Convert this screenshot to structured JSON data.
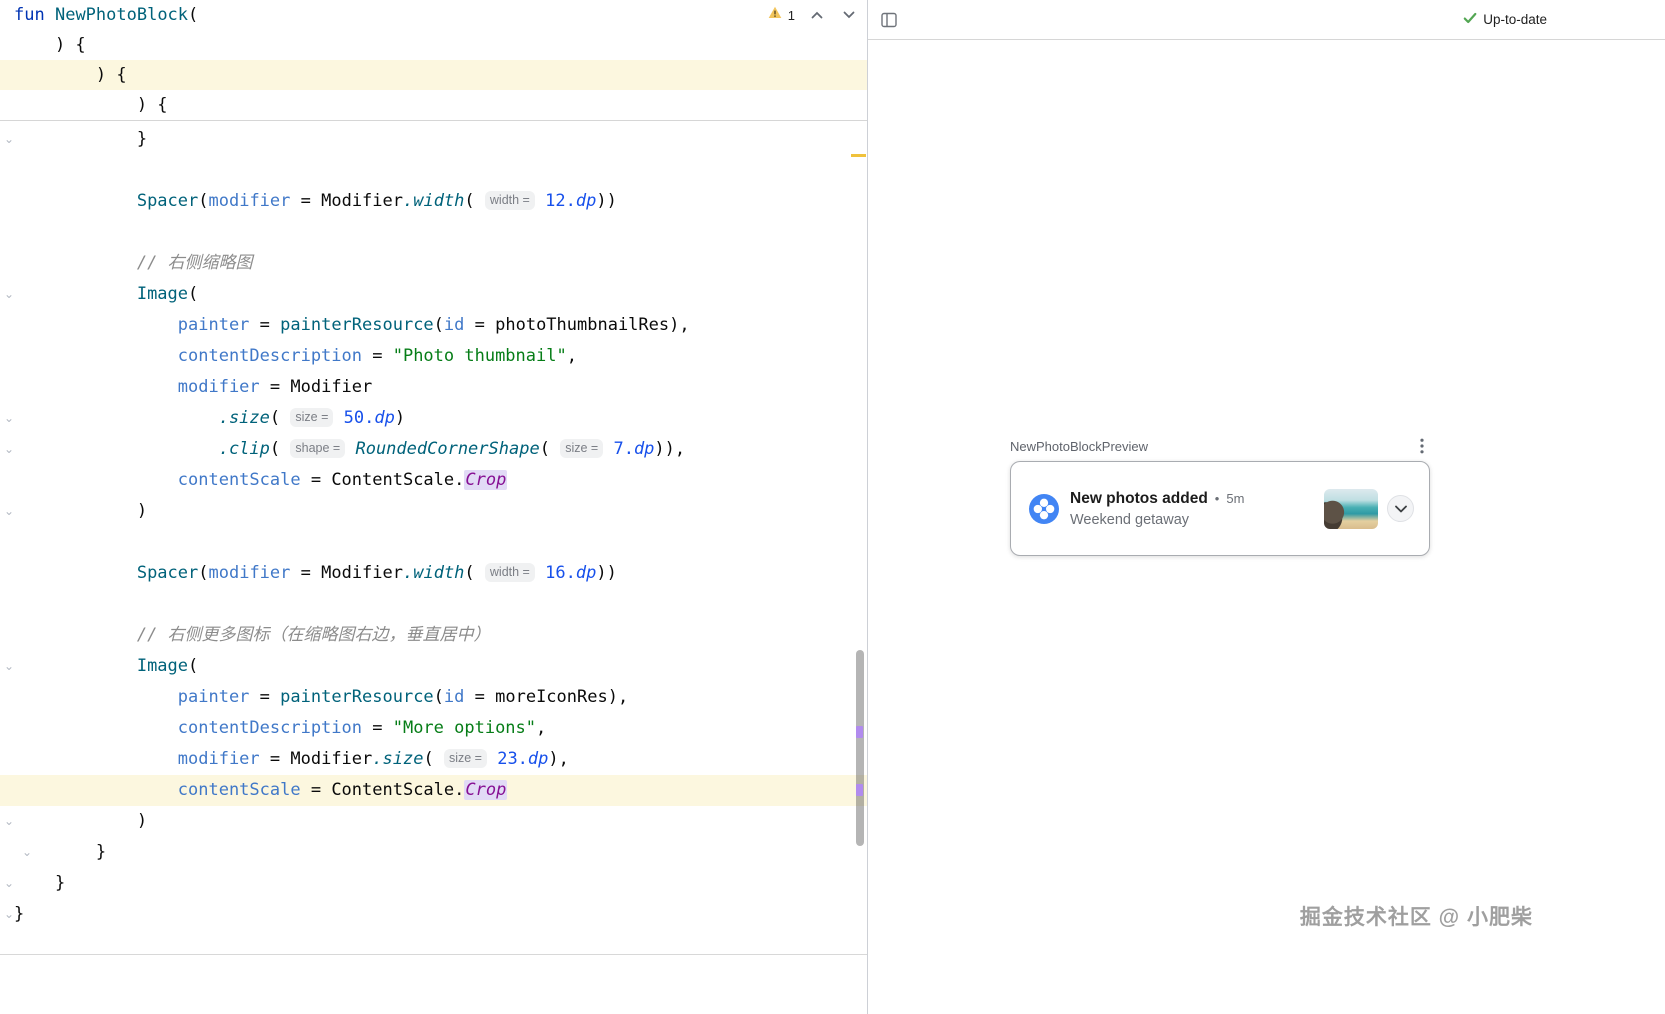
{
  "icons": {
    "fold_glyph": "⌄"
  },
  "editor": {
    "inspections": {
      "warning_count": "1"
    },
    "sticky_lines": [
      {
        "tokens": [
          {
            "t": "fun",
            "c": "kw"
          },
          {
            "t": " ",
            "c": "pl"
          },
          {
            "t": "NewPhotoBlock",
            "c": "fn"
          },
          {
            "t": "(",
            "c": "pl"
          }
        ]
      },
      {
        "tokens": [
          {
            "t": "    ) {",
            "c": "pl"
          }
        ]
      },
      {
        "hl": true,
        "tokens": [
          {
            "t": "        ) {",
            "c": "pl"
          }
        ]
      },
      {
        "tokens": [
          {
            "t": "            ) {",
            "c": "pl"
          }
        ]
      }
    ],
    "lines": [
      {
        "fold": 1,
        "tokens": [
          {
            "t": "            }",
            "c": "pl"
          }
        ]
      },
      {
        "tokens": []
      },
      {
        "tokens": [
          {
            "t": "            ",
            "c": "pl"
          },
          {
            "t": "Spacer",
            "c": "fn"
          },
          {
            "t": "(",
            "c": "pl"
          },
          {
            "t": "modifier",
            "c": "arg"
          },
          {
            "t": " = ",
            "c": "pl"
          },
          {
            "t": "Modifier",
            "c": "pl"
          },
          {
            "t": ".width",
            "c": "ext"
          },
          {
            "t": "( ",
            "c": "pl"
          },
          {
            "t": "width =",
            "c": "hint"
          },
          {
            "t": " ",
            "c": "pl"
          },
          {
            "t": "12.",
            "c": "num"
          },
          {
            "t": "dp",
            "c": "prop"
          },
          {
            "t": "))",
            "c": "pl"
          }
        ]
      },
      {
        "tokens": []
      },
      {
        "tokens": [
          {
            "t": "            ",
            "c": "pl"
          },
          {
            "t": "// 右侧缩略图",
            "c": "cmt"
          }
        ]
      },
      {
        "fold": 1,
        "tokens": [
          {
            "t": "            ",
            "c": "pl"
          },
          {
            "t": "Image",
            "c": "fn"
          },
          {
            "t": "(",
            "c": "pl"
          }
        ]
      },
      {
        "tokens": [
          {
            "t": "                ",
            "c": "pl"
          },
          {
            "t": "painter",
            "c": "arg"
          },
          {
            "t": " = ",
            "c": "pl"
          },
          {
            "t": "painterResource",
            "c": "fn"
          },
          {
            "t": "(",
            "c": "pl"
          },
          {
            "t": "id",
            "c": "arg"
          },
          {
            "t": " = ",
            "c": "pl"
          },
          {
            "t": "photoThumbnailRes",
            "c": "pl"
          },
          {
            "t": "),",
            "c": "pl"
          }
        ]
      },
      {
        "tokens": [
          {
            "t": "                ",
            "c": "pl"
          },
          {
            "t": "contentDescription",
            "c": "arg"
          },
          {
            "t": " = ",
            "c": "pl"
          },
          {
            "t": "\"Photo thumbnail\"",
            "c": "str"
          },
          {
            "t": ",",
            "c": "pl"
          }
        ]
      },
      {
        "tokens": [
          {
            "t": "                ",
            "c": "pl"
          },
          {
            "t": "modifier",
            "c": "arg"
          },
          {
            "t": " = ",
            "c": "pl"
          },
          {
            "t": "Modifier",
            "c": "pl"
          }
        ]
      },
      {
        "fold": 1,
        "tokens": [
          {
            "t": "                    ",
            "c": "pl"
          },
          {
            "t": ".size",
            "c": "ext"
          },
          {
            "t": "( ",
            "c": "pl"
          },
          {
            "t": "size =",
            "c": "hint"
          },
          {
            "t": " ",
            "c": "pl"
          },
          {
            "t": "50.",
            "c": "num"
          },
          {
            "t": "dp",
            "c": "prop"
          },
          {
            "t": ")",
            "c": "pl"
          }
        ]
      },
      {
        "fold": 1,
        "tokens": [
          {
            "t": "                    ",
            "c": "pl"
          },
          {
            "t": ".clip",
            "c": "ext"
          },
          {
            "t": "( ",
            "c": "pl"
          },
          {
            "t": "shape =",
            "c": "hint"
          },
          {
            "t": " ",
            "c": "pl"
          },
          {
            "t": "RoundedCornerShape",
            "c": "ctor"
          },
          {
            "t": "( ",
            "c": "pl"
          },
          {
            "t": "size =",
            "c": "hint"
          },
          {
            "t": " ",
            "c": "pl"
          },
          {
            "t": "7.",
            "c": "num"
          },
          {
            "t": "dp",
            "c": "prop"
          },
          {
            "t": ")),",
            "c": "pl"
          }
        ]
      },
      {
        "tokens": [
          {
            "t": "                ",
            "c": "pl"
          },
          {
            "t": "contentScale",
            "c": "arg"
          },
          {
            "t": " = ",
            "c": "pl"
          },
          {
            "t": "ContentScale.",
            "c": "pl"
          },
          {
            "t": "Crop",
            "c": "hlid"
          }
        ]
      },
      {
        "fold": 1,
        "tokens": [
          {
            "t": "            )",
            "c": "pl"
          }
        ]
      },
      {
        "tokens": []
      },
      {
        "tokens": [
          {
            "t": "            ",
            "c": "pl"
          },
          {
            "t": "Spacer",
            "c": "fn"
          },
          {
            "t": "(",
            "c": "pl"
          },
          {
            "t": "modifier",
            "c": "arg"
          },
          {
            "t": " = ",
            "c": "pl"
          },
          {
            "t": "Modifier",
            "c": "pl"
          },
          {
            "t": ".width",
            "c": "ext"
          },
          {
            "t": "( ",
            "c": "pl"
          },
          {
            "t": "width =",
            "c": "hint"
          },
          {
            "t": " ",
            "c": "pl"
          },
          {
            "t": "16.",
            "c": "num"
          },
          {
            "t": "dp",
            "c": "prop"
          },
          {
            "t": "))",
            "c": "pl"
          }
        ]
      },
      {
        "tokens": []
      },
      {
        "tokens": [
          {
            "t": "            ",
            "c": "pl"
          },
          {
            "t": "// 右侧更多图标（在缩略图右边，垂直居中）",
            "c": "cmt"
          }
        ]
      },
      {
        "fold": 1,
        "tokens": [
          {
            "t": "            ",
            "c": "pl"
          },
          {
            "t": "Image",
            "c": "fn"
          },
          {
            "t": "(",
            "c": "pl"
          }
        ]
      },
      {
        "tokens": [
          {
            "t": "                ",
            "c": "pl"
          },
          {
            "t": "painter",
            "c": "arg"
          },
          {
            "t": " = ",
            "c": "pl"
          },
          {
            "t": "painterResource",
            "c": "fn"
          },
          {
            "t": "(",
            "c": "pl"
          },
          {
            "t": "id",
            "c": "arg"
          },
          {
            "t": " = ",
            "c": "pl"
          },
          {
            "t": "moreIconRes",
            "c": "pl"
          },
          {
            "t": "),",
            "c": "pl"
          }
        ]
      },
      {
        "tokens": [
          {
            "t": "                ",
            "c": "pl"
          },
          {
            "t": "contentDescription",
            "c": "arg"
          },
          {
            "t": " = ",
            "c": "pl"
          },
          {
            "t": "\"More options\"",
            "c": "str"
          },
          {
            "t": ",",
            "c": "pl"
          }
        ]
      },
      {
        "tokens": [
          {
            "t": "                ",
            "c": "pl"
          },
          {
            "t": "modifier",
            "c": "arg"
          },
          {
            "t": " = ",
            "c": "pl"
          },
          {
            "t": "Modifier",
            "c": "pl"
          },
          {
            "t": ".size",
            "c": "ext"
          },
          {
            "t": "( ",
            "c": "pl"
          },
          {
            "t": "size =",
            "c": "hint"
          },
          {
            "t": " ",
            "c": "pl"
          },
          {
            "t": "23.",
            "c": "num"
          },
          {
            "t": "dp",
            "c": "prop"
          },
          {
            "t": "),",
            "c": "pl"
          }
        ]
      },
      {
        "hl": true,
        "tokens": [
          {
            "t": "                ",
            "c": "pl"
          },
          {
            "t": "contentScale",
            "c": "arg"
          },
          {
            "t": " = ",
            "c": "pl"
          },
          {
            "t": "ContentScale.",
            "c": "pl"
          },
          {
            "t": "Crop",
            "c": "hlid"
          }
        ]
      },
      {
        "fold": 1,
        "tokens": [
          {
            "t": "            )",
            "c": "pl"
          }
        ]
      },
      {
        "fold": 2,
        "tokens": [
          {
            "t": "        }",
            "c": "pl"
          }
        ]
      },
      {
        "fold": 1,
        "tokens": [
          {
            "t": "    }",
            "c": "pl"
          }
        ]
      },
      {
        "fold": 1,
        "tokens": [
          {
            "t": "}",
            "c": "pl"
          }
        ]
      }
    ]
  },
  "preview": {
    "toolbar": {
      "status": "Up-to-date"
    },
    "preview_name": "NewPhotoBlockPreview",
    "card": {
      "title": "New photos added",
      "separator": "•",
      "time": "5m",
      "subtitle": "Weekend getaway"
    },
    "watermark": "掘金技术社区 @ 小肥柴"
  }
}
